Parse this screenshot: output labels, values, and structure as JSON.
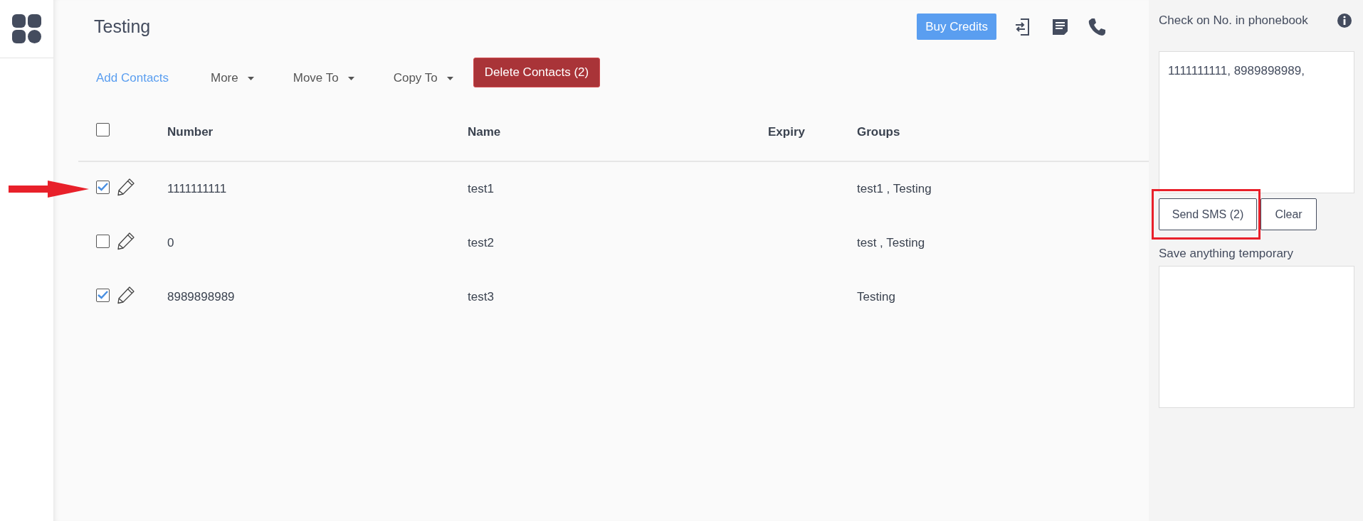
{
  "header": {
    "title": "Testing",
    "buy_button": "Buy Credits"
  },
  "toolbar": {
    "add_link": "Add Contacts",
    "menus": [
      "More",
      "Move To",
      "Copy To"
    ],
    "delete_button": "Delete Contacts (2)"
  },
  "table": {
    "all_checked": false,
    "columns": [
      "Number",
      "Name",
      "Expiry",
      "Groups"
    ],
    "rows": [
      {
        "checked": true,
        "pointed": true,
        "number": "1111111111",
        "name": "test1",
        "groups": "test1 , Testing"
      },
      {
        "checked": false,
        "pointed": false,
        "number": "0",
        "name": "test2",
        "groups": "test , Testing"
      },
      {
        "checked": true,
        "pointed": false,
        "number": "8989898989",
        "name": "test3",
        "groups": "Testing"
      }
    ]
  },
  "side_panel": {
    "title": "Check on No. in phonebook",
    "numbers": "1111111111, 8989898989,",
    "send_button": {
      "label": "Send SMS (2)",
      "highlighted": true
    },
    "clear_button": "Clear",
    "temp_label": "Save anything temporary"
  }
}
